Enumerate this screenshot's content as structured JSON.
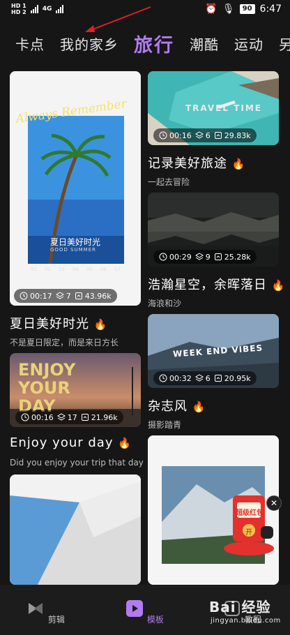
{
  "status_bar": {
    "net_top": "HD 1",
    "net_bottom": "HD 2",
    "signal": "4G",
    "battery": "90",
    "time": "6:47"
  },
  "tabs": [
    {
      "label": "卡点"
    },
    {
      "label": "我的家乡"
    },
    {
      "label": "旅行",
      "active": true
    },
    {
      "label": "潮酷"
    },
    {
      "label": "运动"
    },
    {
      "label": "另"
    }
  ],
  "cards": {
    "summer": {
      "overlay_script": "Always Remember",
      "overlay_caption": "夏日美好时光",
      "overlay_sub": "GOOD SUMMER",
      "duration": "00:17",
      "layers": "7",
      "uses": "43.96k",
      "title": "夏日美好时光",
      "subtitle": "不是夏日限定，而是来日方长"
    },
    "travel": {
      "overlay_text": "TRAVEL TIME",
      "duration": "00:16",
      "layers": "6",
      "uses": "29.83k",
      "title": "记录美好旅途",
      "subtitle": "一起去冒险"
    },
    "stars": {
      "duration": "00:29",
      "layers": "9",
      "uses": "25.28k",
      "title": "浩瀚星空，余晖落日",
      "subtitle": "海浪和沙"
    },
    "enjoy": {
      "overlay_text_1": "ENJOY",
      "overlay_text_2": "YOUR",
      "overlay_text_3": "DAY",
      "duration": "00:16",
      "layers": "17",
      "uses": "21.96k",
      "title": "Enjoy your day",
      "subtitle": "Did you enjoy your trip that day"
    },
    "weekend": {
      "overlay_text": "WEEK END VIBES",
      "duration": "00:32",
      "layers": "6",
      "uses": "20.95k",
      "title": "杂志风",
      "subtitle": "摄影踏青"
    }
  },
  "promo": {
    "close": "✕",
    "line1": "超级红包",
    "line2": "开"
  },
  "bottom_nav": [
    {
      "label": "剪辑",
      "icon": "scissors-icon"
    },
    {
      "label": "模板",
      "icon": "template-icon",
      "active": true
    },
    {
      "label": "教程",
      "icon": "tutorial-icon"
    }
  ],
  "watermark": {
    "main": "Bai 经验",
    "sub": "jingyan.baidu.com"
  },
  "colors": {
    "background": "#161616",
    "accent": "#b07cf0",
    "flame": "#ff8a1f"
  }
}
